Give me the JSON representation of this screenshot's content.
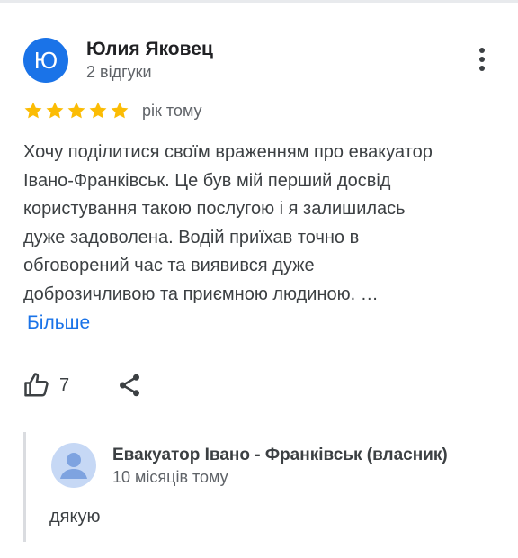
{
  "author": {
    "initial": "Ю",
    "name": "Юлия Яковец",
    "reviews_count": "2 відгуки"
  },
  "review": {
    "rating": 5,
    "rating_max": 5,
    "date": "рік тому",
    "text_lines": [
      "Хочу поділитися своїм враженням про евакуатор",
      "Івано-Франківськ. Це був мій перший досвід",
      "користування такою послугою і я залишилась",
      "дуже задоволена. Водій приїхав точно в",
      "обговорений час та виявився дуже",
      "доброзичливою та приємною людиною. …"
    ],
    "more_label": "Більше",
    "likes": "7"
  },
  "owner_reply": {
    "name": "Евакуатор Івано - Франківськ (власник)",
    "date": "10 місяців тому",
    "text": "дякую"
  },
  "icons": {
    "more": "more-vertical-icon",
    "star": "star-icon",
    "like": "thumbs-up-icon",
    "share": "share-icon",
    "owner_avatar": "person-icon"
  },
  "colors": {
    "avatar": "#1a73e8",
    "star": "#fbbc04",
    "link": "#1a73e8",
    "owner_avatar_bg": "#c6d8f5",
    "owner_avatar_fg": "#7ea3e0"
  }
}
